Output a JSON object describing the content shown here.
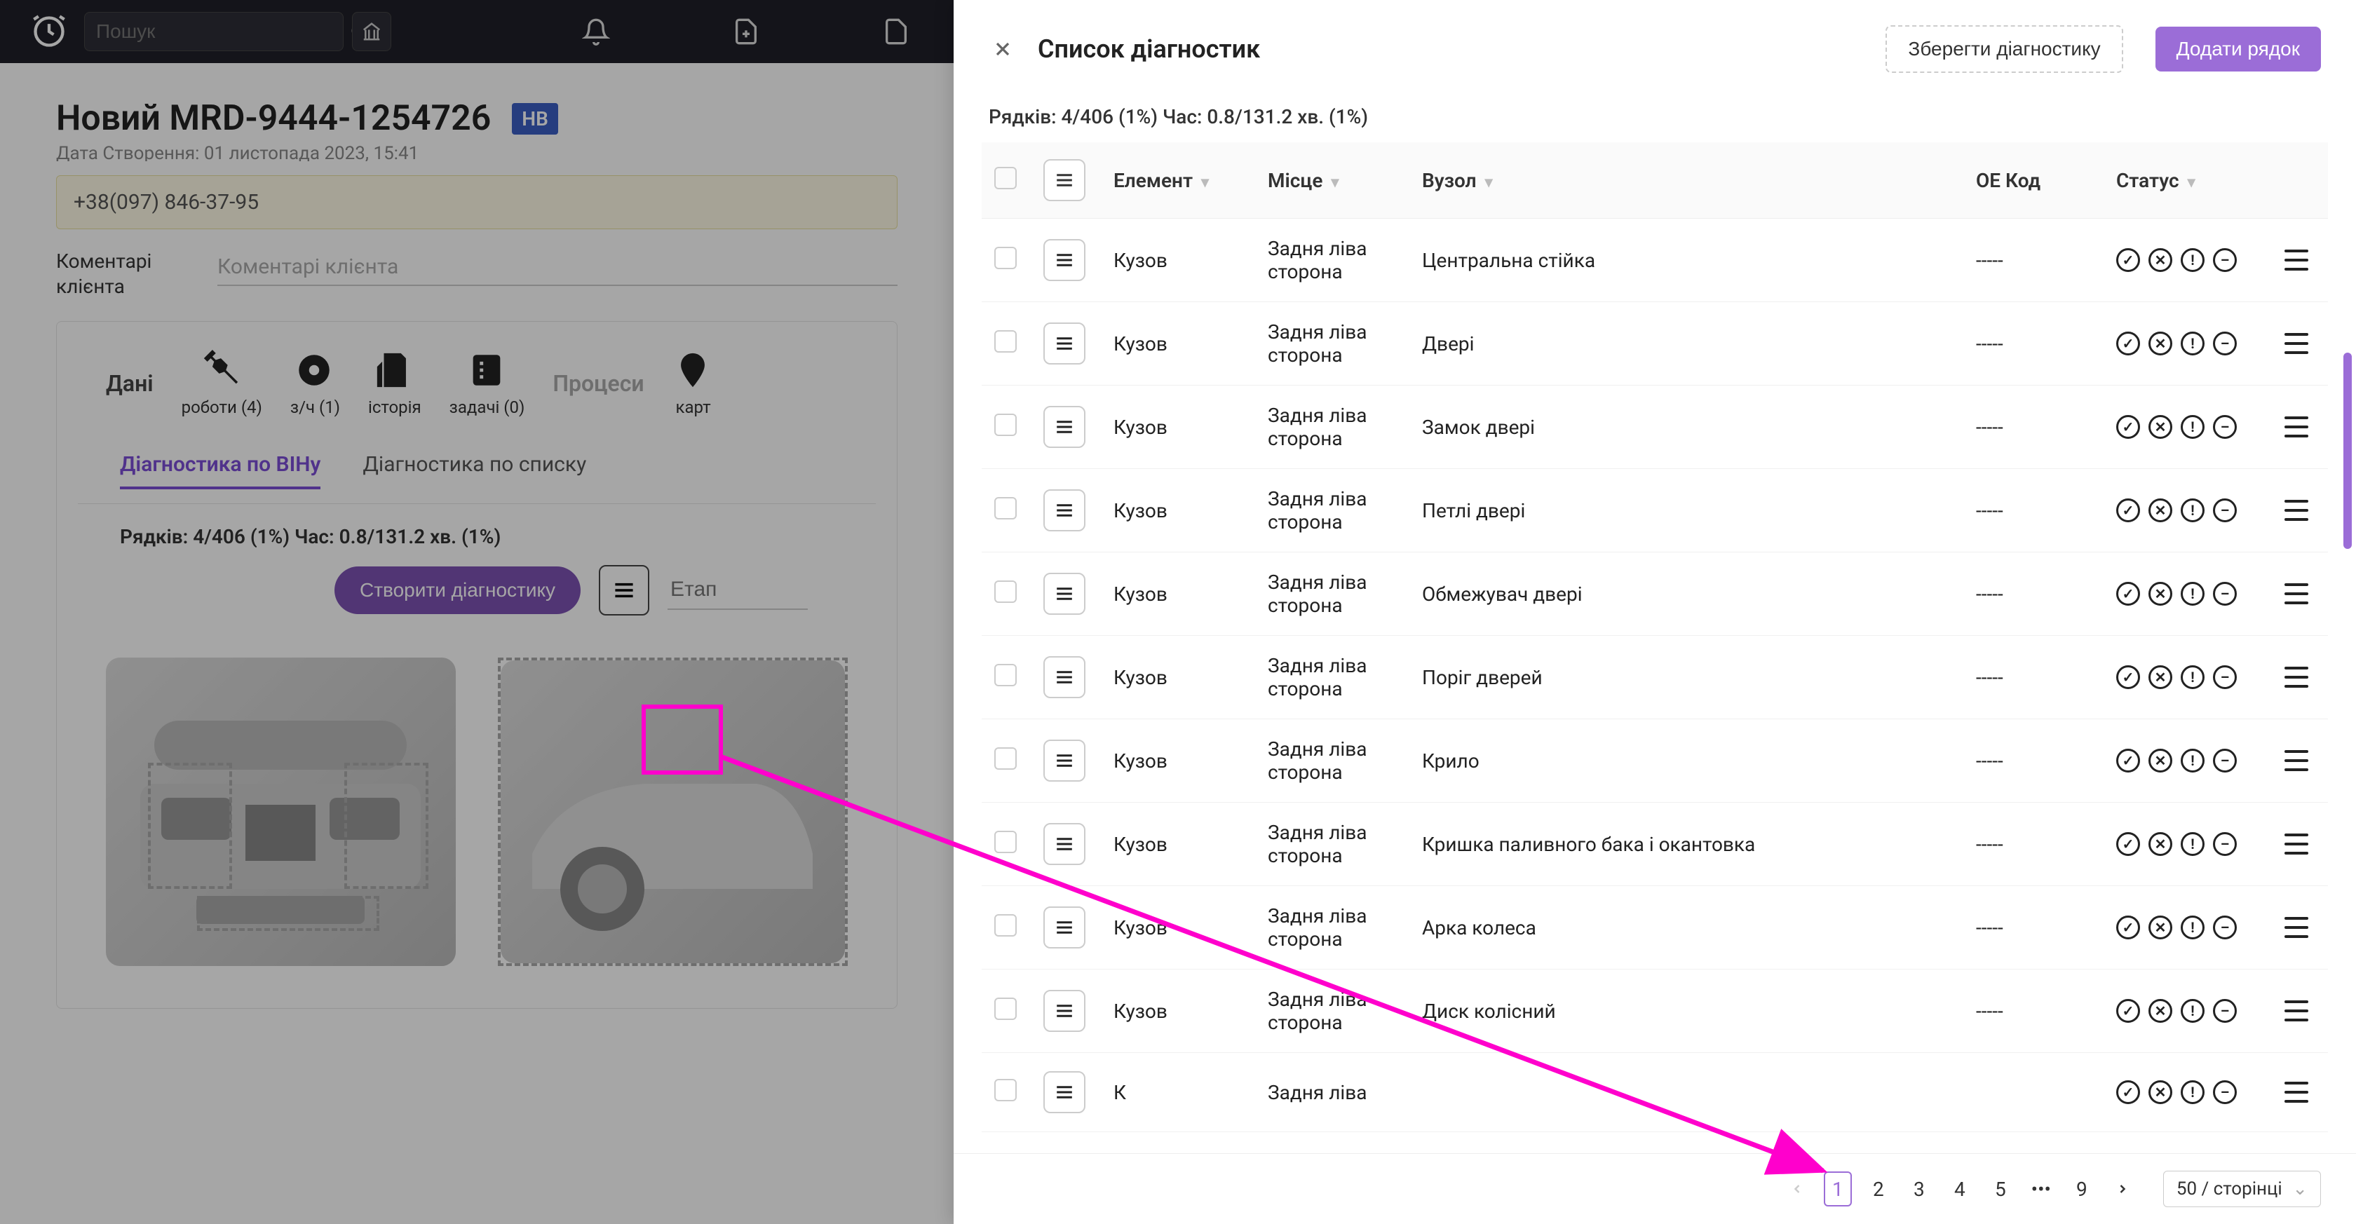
{
  "topbar": {
    "search_placeholder": "Пошук"
  },
  "header": {
    "title": "Новий MRD-9444-1254726",
    "badge": "НВ",
    "subtitle": "Дата Створення: 01 листопада 2023, 15:41"
  },
  "left": {
    "phone": "+38(097) 846-37-95",
    "comment_label": "Коментарі клієнта",
    "comment_placeholder": "Коментарі клієнта",
    "main_tabs": {
      "dani": "Дані",
      "roboty": "роботи (4)",
      "zch": "з/ч (1)",
      "istoriya": "історія",
      "zadachi": "задачі (0)",
      "procesy": "Процеси",
      "kart": "карт"
    },
    "inner_tabs": {
      "vin": "Діагностика по ВІНу",
      "list": "Діагностика по списку"
    },
    "diag_stats": "Рядків: 4/406 (1%) Час: 0.8/131.2 хв. (1%)",
    "create_btn": "Створити діагностику",
    "stage_placeholder": "Етап"
  },
  "drawer": {
    "title": "Список діагностик",
    "save_btn": "Зберегти діагностику",
    "add_btn": "Додати рядок",
    "stats": "Рядків: 4/406 (1%) Час: 0.8/131.2 хв. (1%)",
    "columns": {
      "element": "Елемент",
      "place": "Місце",
      "node": "Вузол",
      "oe": "OE Код",
      "status": "Статус"
    },
    "rows": [
      {
        "element": "Кузов",
        "place": "Задня ліва сторона",
        "node": "Центральна стійка",
        "oe": "-----"
      },
      {
        "element": "Кузов",
        "place": "Задня ліва сторона",
        "node": "Двері",
        "oe": "-----"
      },
      {
        "element": "Кузов",
        "place": "Задня ліва сторона",
        "node": "Замок двері",
        "oe": "-----"
      },
      {
        "element": "Кузов",
        "place": "Задня ліва сторона",
        "node": "Петлі двері",
        "oe": "-----"
      },
      {
        "element": "Кузов",
        "place": "Задня ліва сторона",
        "node": "Обмежувач двері",
        "oe": "-----"
      },
      {
        "element": "Кузов",
        "place": "Задня ліва сторона",
        "node": "Поріг дверей",
        "oe": "-----"
      },
      {
        "element": "Кузов",
        "place": "Задня ліва сторона",
        "node": "Крило",
        "oe": "-----"
      },
      {
        "element": "Кузов",
        "place": "Задня ліва сторона",
        "node": "Кришка паливного бака і окантовка",
        "oe": "-----"
      },
      {
        "element": "Кузов",
        "place": "Задня ліва сторона",
        "node": "Арка колеса",
        "oe": "-----"
      },
      {
        "element": "Кузов",
        "place": "Задня ліва сторона",
        "node": "Диск колісний",
        "oe": "-----"
      },
      {
        "element": "К",
        "place": "Задня ліва",
        "node": "",
        "oe": ""
      }
    ],
    "pagination": {
      "pages": [
        "1",
        "2",
        "3",
        "4",
        "5",
        "•••",
        "9"
      ],
      "page_size": "50 / сторінці"
    }
  }
}
